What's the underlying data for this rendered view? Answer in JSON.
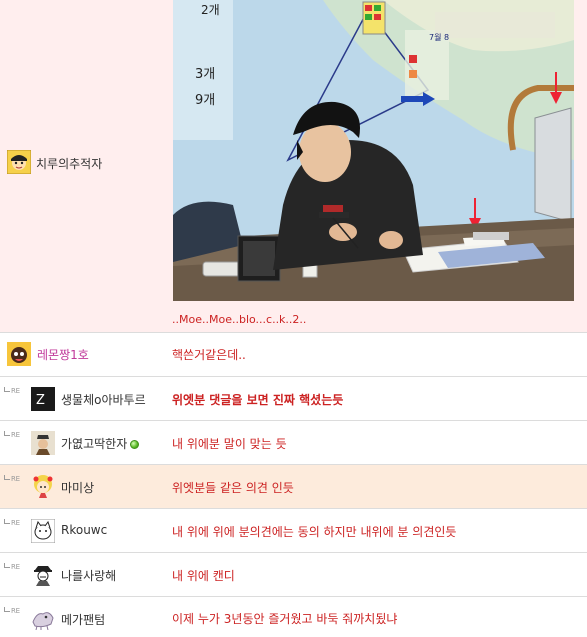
{
  "post": {
    "author": "치루의추적자",
    "image_caption": "..Moe..Moe..blo...c..k..2..",
    "map_labels": [
      "2개",
      "3개",
      "9개",
      "7월 8"
    ]
  },
  "comments": [
    {
      "is_reply": false,
      "reply_tag": "",
      "nickname": "레몬짱1호",
      "nickname_color": "#c0399a",
      "text": "핵쓴거같은데..",
      "text_color": "#cc2222",
      "bold": false,
      "online": false,
      "background": "#ffffff"
    },
    {
      "is_reply": true,
      "reply_tag": "RE",
      "nickname": "생물체o아바투르",
      "nickname_color": "#333333",
      "text": "위엣분 댓글을 보면 진짜 핵셨는듯",
      "text_color": "#cc2222",
      "bold": true,
      "online": false,
      "background": "#ffffff"
    },
    {
      "is_reply": true,
      "reply_tag": "RE",
      "nickname": "가엾고딱한자",
      "nickname_color": "#333333",
      "text": "내 위에분 말이 맞는 듯",
      "text_color": "#cc2222",
      "bold": false,
      "online": true,
      "background": "#ffffff"
    },
    {
      "is_reply": true,
      "reply_tag": "RE",
      "nickname": "마미상",
      "nickname_color": "#333333",
      "text": "위엣분들 같은 의견 인듯",
      "text_color": "#cc2222",
      "bold": false,
      "online": false,
      "background": "#fdebdc"
    },
    {
      "is_reply": true,
      "reply_tag": "RE",
      "nickname": "Rkouwc",
      "nickname_color": "#333333",
      "text": "내 위에 위에 분의견에는 동의 하지만 내위에 분 의견인듯",
      "text_color": "#cc2222",
      "bold": false,
      "online": false,
      "background": "#ffffff"
    },
    {
      "is_reply": true,
      "reply_tag": "RE",
      "nickname": "나를사랑해",
      "nickname_color": "#333333",
      "text": "내 위에 캔디",
      "text_color": "#cc2222",
      "bold": false,
      "online": false,
      "background": "#ffffff"
    },
    {
      "is_reply": true,
      "reply_tag": "RE",
      "nickname": "메가팬텀",
      "nickname_color": "#333333",
      "text": "이제 누가 3년동안 즐거웠고 바둑 줘까치됬냐",
      "text_color": "#cc2222",
      "bold": false,
      "online": false,
      "background": "#ffffff"
    }
  ]
}
